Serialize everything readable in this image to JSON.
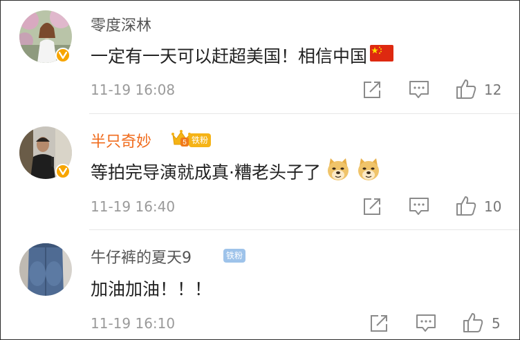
{
  "comments": [
    {
      "username": "零度深林",
      "text": "一定有一天可以赶超美国！相信中国",
      "time": "11-19 16:08",
      "likes": "12",
      "flag_icon": "china-flag-icon",
      "verified": true
    },
    {
      "username": "半只奇妙",
      "badge": "铁粉",
      "vip_level": "5",
      "text": "等拍完导演就成真·糟老头子了",
      "time": "11-19 16:40",
      "likes": "10",
      "emoji_icon": "doge-emoji-icon",
      "verified": true
    },
    {
      "username": "牛仔裤的夏天9",
      "badge": "铁粉",
      "text": "加油加油！！！",
      "time": "11-19 16:10",
      "likes": "5",
      "verified": false
    }
  ],
  "colors": {
    "username": "#555555",
    "vip_username": "#f06b1c",
    "time": "#9a9a9a",
    "icon": "#8a8a8a",
    "verified_badge": "#f7a500",
    "fan_badge": "#9ec3ea"
  }
}
